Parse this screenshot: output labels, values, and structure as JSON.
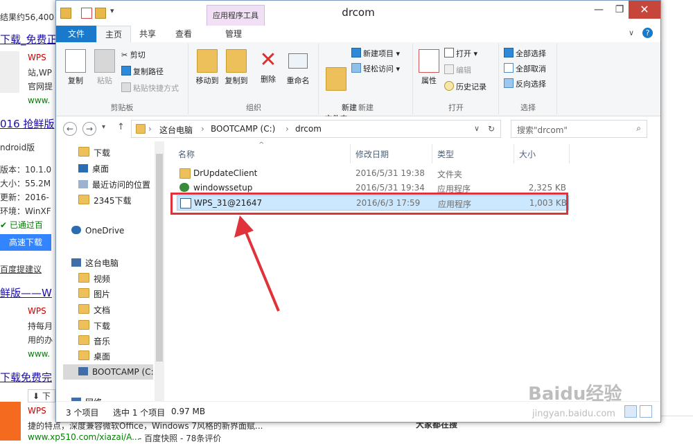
{
  "background": {
    "result_count": "结果约56,400",
    "lines": [
      {
        "text": "下载_免费正",
        "kind": "link"
      },
      {
        "text": "WPS",
        "kind": "red"
      },
      {
        "text": "站,WP",
        "kind": "text"
      },
      {
        "text": "官网提",
        "kind": "text"
      },
      {
        "text": "www.",
        "kind": "green"
      },
      {
        "text": "016 抢鲜版",
        "kind": "link"
      },
      {
        "text": "ndroid版",
        "kind": "text"
      },
      {
        "text": "版本：10.1.0",
        "kind": "text"
      },
      {
        "text": "大小：55.2M",
        "kind": "text"
      },
      {
        "text": "更新：2016-",
        "kind": "text"
      },
      {
        "text": "环境：WinXF",
        "kind": "text"
      },
      {
        "text": "已通过百",
        "kind": "green"
      },
      {
        "text": "百度提建议",
        "kind": "text"
      },
      {
        "text": "鲜版——W",
        "kind": "link"
      },
      {
        "text": "WPS",
        "kind": "red"
      },
      {
        "text": "持每月",
        "kind": "text"
      },
      {
        "text": "用的办",
        "kind": "text"
      },
      {
        "text": "www.",
        "kind": "green"
      },
      {
        "text": "下载免费完",
        "kind": "link"
      },
      {
        "text": "下",
        "kind": "text"
      },
      {
        "text": "WPS",
        "kind": "red"
      },
      {
        "text": "捷的特点，深度兼容微软Office，Windows 7风格的新界面赋...",
        "kind": "text"
      },
      {
        "text": "www.xp510.com/xiazai/A...",
        "kind": "green"
      }
    ],
    "download_button": "高速下载",
    "bottom_right": "大家都在搜",
    "bottom_extra": "- 百度快照 - 78条评价",
    "watermark": "Baidu经验",
    "watermark_url": "jingyan.baidu.com"
  },
  "window": {
    "title": "drcom",
    "context_tab_group": "应用程序工具",
    "tabs": [
      "文件",
      "主页",
      "共享",
      "查看",
      "管理"
    ],
    "ribbon": {
      "clipboard": {
        "label": "剪贴板",
        "copy": "复制",
        "paste": "粘贴",
        "cut": "剪切",
        "copy_path": "复制路径",
        "paste_shortcut": "粘贴快捷方式"
      },
      "organize": {
        "label": "组织",
        "move_to": "移动到",
        "copy_to": "复制到",
        "delete": "删除",
        "rename": "重命名"
      },
      "new": {
        "label": "新建",
        "new_folder": "新建\n文件夹",
        "new_item": "新建项目 ▾",
        "easy_access": "轻松访问 ▾"
      },
      "open": {
        "label": "打开",
        "properties": "属性",
        "open": "打开 ▾",
        "edit": "编辑",
        "history": "历史记录"
      },
      "select": {
        "label": "选择",
        "select_all": "全部选择",
        "select_none": "全部取消",
        "invert": "反向选择"
      }
    },
    "address": {
      "crumbs": [
        "这台电脑",
        "BOOTCAMP (C:)",
        "drcom"
      ],
      "search_placeholder": "搜索\"drcom\""
    },
    "nav": {
      "quick": [
        "下载",
        "桌面",
        "最近访问的位置",
        "2345下载"
      ],
      "onedrive": "OneDrive",
      "this_pc": "这台电脑",
      "pc_items": [
        "视频",
        "图片",
        "文档",
        "下载",
        "音乐",
        "桌面",
        "BOOTCAMP (C:"
      ],
      "network": "网络"
    },
    "columns": [
      "名称",
      "修改日期",
      "类型",
      "大小"
    ],
    "files": [
      {
        "name": "DrUpdateClient",
        "date": "2016/5/31 19:38",
        "type": "文件夹",
        "size": "",
        "icon": "folder-icon"
      },
      {
        "name": "windowssetup",
        "date": "2016/5/31 19:34",
        "type": "应用程序",
        "size": "2,325 KB",
        "icon": "globe-app-icon"
      },
      {
        "name": "WPS_31@21647",
        "date": "2016/6/3 17:59",
        "type": "应用程序",
        "size": "1,003 KB",
        "icon": "installer-app-icon"
      }
    ],
    "status": {
      "count": "3 个项目",
      "selected": "选中 1 个项目",
      "size": "0.97 MB"
    }
  },
  "colors": {
    "file_tab": "#1979ca",
    "context_tab": "#f0dff5",
    "selection": "#cce8ff",
    "annotation_red": "#e0323a",
    "close_button": "#c7463c"
  }
}
